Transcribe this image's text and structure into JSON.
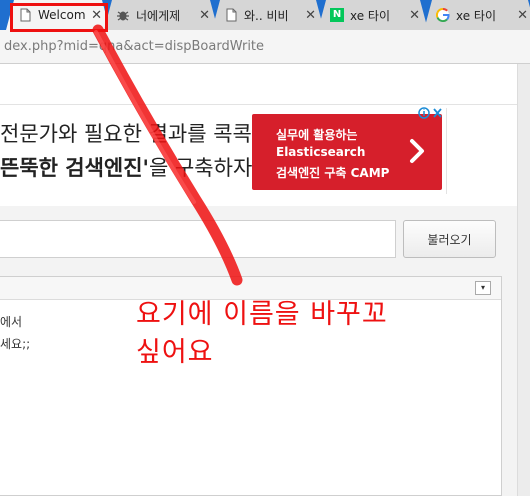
{
  "tabs": [
    {
      "label": "Welcom",
      "icon": "page-icon",
      "active": true
    },
    {
      "label": "너에게제",
      "icon": "bug-icon",
      "active": false
    },
    {
      "label": "와.. 비비",
      "icon": "page-icon",
      "active": false
    },
    {
      "label": "xe 타이",
      "icon": "naver-icon",
      "active": false
    },
    {
      "label": "xe 타이",
      "icon": "google-icon",
      "active": false
    }
  ],
  "tab_close_glyph": "✕",
  "naver_letter": "N",
  "address": {
    "url": "dex.php?mid=qna&act=dispBoardWrite"
  },
  "ad": {
    "line1": "전문가와 필요한 결과를 콕콕",
    "line2_bold": "뜬뚝한 검색엔진'",
    "line2_rest": "을 구축하자!",
    "banner": {
      "line1": "실무에 활용하는",
      "line2": "Elasticsearch",
      "line3": "검색엔진 구축 CAMP"
    },
    "adchoice_close": "✕"
  },
  "form": {
    "load_button": "불러오기"
  },
  "editor": {
    "line1": "에서",
    "line2": "세요;;",
    "dropdown_glyph": "▾"
  },
  "annotation": {
    "line1": "요기에 이름을 바꾸꼬",
    "line2": "싶어요",
    "color": "#ee1111"
  },
  "colors": {
    "tabbar": "#1f6fcf",
    "ad_banner": "#d61f2b"
  }
}
